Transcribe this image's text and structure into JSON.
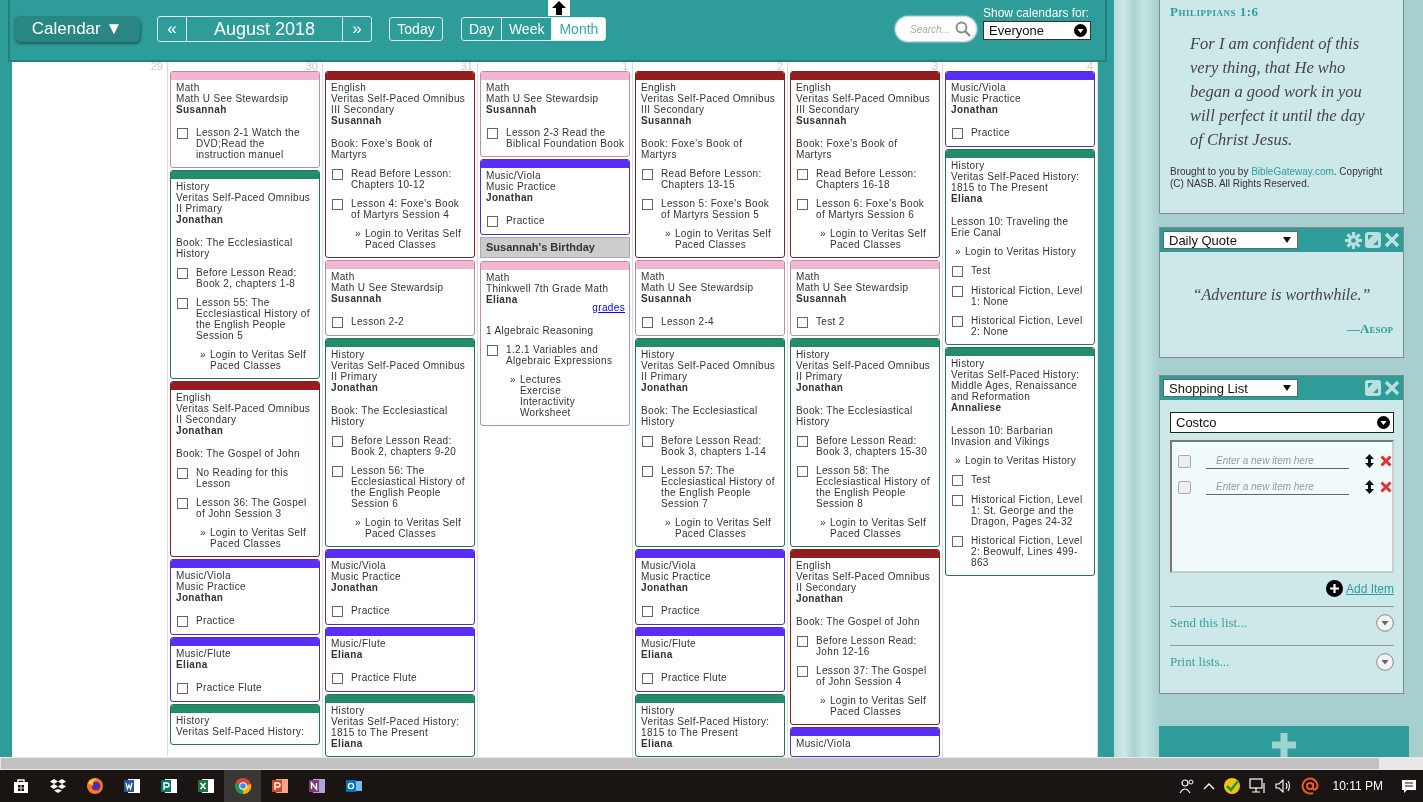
{
  "header": {
    "menu_button": "Calendar ▼",
    "prev": "«",
    "month": "August 2018",
    "next": "»",
    "today": "Today",
    "views": [
      {
        "label": "Day",
        "selected": false
      },
      {
        "label": "Week",
        "selected": false
      },
      {
        "label": "Month",
        "selected": true
      }
    ],
    "search": {
      "placeholder": "Search..."
    },
    "show_label": "Show calendars for:",
    "show_select": "Everyone"
  },
  "calendar": {
    "days": [
      {
        "number": "29"
      },
      {
        "number": "30",
        "cards": [
          {
            "kind": "lesson",
            "color": "#f4b5d3",
            "subject": "Math",
            "course": "Math U See Stewardsip",
            "student": "Susannah",
            "items": [
              {
                "kind": "task",
                "text": "Lesson 2-1 Watch the DVD;Read the instruction manuel",
                "checked": false
              }
            ]
          },
          {
            "kind": "lesson",
            "color": "#238c6b",
            "subject": "History",
            "course": "Veritas Self-Paced Omnibus II Primary",
            "student": "Jonathan",
            "items": [
              {
                "kind": "note",
                "text": "Book: The Ecclesiastical History"
              },
              {
                "kind": "task",
                "text": "Before Lesson Read: Book 2, chapters 1-8",
                "checked": false
              },
              {
                "kind": "task",
                "text": "Lesson 55: The Ecclesiastical History of the English People Session 5",
                "checked": false
              },
              {
                "kind": "link",
                "marker": "»",
                "labels": [
                  "Login to Veritas Self Paced Classes"
                ]
              }
            ]
          },
          {
            "kind": "lesson",
            "color": "#951d1d",
            "subject": "English",
            "course": "Veritas Self-Paced Omnibus II Secondary",
            "student": "Jonathan",
            "items": [
              {
                "kind": "note",
                "text": "Book: The Gospel of John"
              },
              {
                "kind": "task",
                "text": "No Reading for this Lesson",
                "checked": false
              },
              {
                "kind": "task",
                "text": "Lesson 36: The Gospel of John Session 3",
                "checked": false
              },
              {
                "kind": "link",
                "marker": "»",
                "labels": [
                  "Login to Veritas Self Paced Classes"
                ]
              }
            ]
          },
          {
            "kind": "lesson",
            "color": "#5b2ef5",
            "subject": "Music/Viola",
            "course": "Music Practice",
            "student": "Jonathan",
            "items": [
              {
                "kind": "task",
                "text": "Practice",
                "checked": false
              }
            ]
          },
          {
            "kind": "lesson",
            "color": "#5b2ef5",
            "subject": "Music/Flute",
            "student": "Eliana",
            "items": [
              {
                "kind": "task",
                "text": "Practice Flute",
                "checked": false
              }
            ]
          },
          {
            "kind": "lesson",
            "color": "#238c6b",
            "subject": "History",
            "course": "Veritas Self-Paced History:"
          }
        ]
      },
      {
        "number": "31",
        "cards": [
          {
            "kind": "lesson",
            "color": "#951d1d",
            "subject": "English",
            "course": "Veritas Self-Paced Omnibus III Secondary",
            "student": "Susannah",
            "items": [
              {
                "kind": "note",
                "text": "Book: Foxe’s Book of Martyrs"
              },
              {
                "kind": "task",
                "text": "Read Before Lesson: Chapters 10-12",
                "checked": false
              },
              {
                "kind": "task",
                "text": "Lesson 4: Foxe's Book of Martyrs Session 4",
                "checked": false
              },
              {
                "kind": "link",
                "marker": "»",
                "labels": [
                  "Login to Veritas Self Paced Classes"
                ]
              }
            ]
          },
          {
            "kind": "lesson",
            "color": "#f4b5d3",
            "subject": "Math",
            "course": "Math U See Stewardsip",
            "student": "Susannah",
            "items": [
              {
                "kind": "task",
                "text": "Lesson 2-2",
                "checked": false
              }
            ]
          },
          {
            "kind": "lesson",
            "color": "#238c6b",
            "subject": "History",
            "course": "Veritas Self-Paced Omnibus II Primary",
            "student": "Jonathan",
            "items": [
              {
                "kind": "note",
                "text": "Book: The Ecclesiastical History"
              },
              {
                "kind": "task",
                "text": "Before Lesson Read: Book 2, chapters 9-20",
                "checked": false
              },
              {
                "kind": "task",
                "text": "Lesson 56: The Ecclesiastical History of the English People Session 6",
                "checked": false
              },
              {
                "kind": "link",
                "marker": "»",
                "labels": [
                  "Login to Veritas Self Paced Classes"
                ]
              }
            ]
          },
          {
            "kind": "lesson",
            "color": "#5b2ef5",
            "subject": "Music/Viola",
            "course": "Music Practice",
            "student": "Jonathan",
            "items": [
              {
                "kind": "task",
                "text": "Practice",
                "checked": false
              }
            ]
          },
          {
            "kind": "lesson",
            "color": "#5b2ef5",
            "subject": "Music/Flute",
            "student": "Eliana",
            "items": [
              {
                "kind": "task",
                "text": "Practice Flute",
                "checked": false
              }
            ]
          },
          {
            "kind": "lesson",
            "color": "#238c6b",
            "subject": "History",
            "course": "Veritas Self-Paced History: 1815 to The Present",
            "student": "Eliana"
          }
        ]
      },
      {
        "number": "1",
        "cards": [
          {
            "kind": "lesson",
            "color": "#f4b5d3",
            "subject": "Math",
            "course": "Math U See Stewardsip",
            "student": "Susannah",
            "items": [
              {
                "kind": "task",
                "text": "Lesson 2-3 Read the Biblical Foundation Book",
                "checked": false
              }
            ]
          },
          {
            "kind": "lesson",
            "color": "#5b2ef5",
            "subject": "Music/Viola",
            "course": "Music Practice",
            "student": "Jonathan",
            "items": [
              {
                "kind": "task",
                "text": "Practice",
                "checked": false
              }
            ]
          },
          {
            "kind": "event",
            "title": "Susannah's Birthday"
          },
          {
            "kind": "lesson",
            "color": "#f4b5d3",
            "subject": "Math",
            "course": "Thinkwell 7th Grade Math",
            "student": "Eliana",
            "grades": "grades",
            "items": [
              {
                "kind": "note",
                "text": "1 Algebraic Reasoning"
              },
              {
                "kind": "task",
                "text": "1.2.1 Variables and Algebraic Expressions",
                "checked": false
              },
              {
                "kind": "link",
                "marker": "»",
                "labels": [
                  "Lectures",
                  "Exercise",
                  "Interactivity",
                  "Worksheet"
                ]
              }
            ]
          }
        ]
      },
      {
        "number": "2",
        "cards": [
          {
            "kind": "lesson",
            "color": "#951d1d",
            "subject": "English",
            "course": "Veritas Self-Paced Omnibus III Secondary",
            "student": "Susannah",
            "items": [
              {
                "kind": "note",
                "text": "Book: Foxe’s Book of Martyrs"
              },
              {
                "kind": "task",
                "text": "Read Before Lesson: Chapters 13-15",
                "checked": false
              },
              {
                "kind": "task",
                "text": "Lesson 5: Foxe's Book of Martyrs Session 5",
                "checked": false
              },
              {
                "kind": "link",
                "marker": "»",
                "labels": [
                  "Login to Veritas Self Paced Classes"
                ]
              }
            ]
          },
          {
            "kind": "lesson",
            "color": "#f4b5d3",
            "subject": "Math",
            "course": "Math U See Stewardsip",
            "student": "Susannah",
            "items": [
              {
                "kind": "task",
                "text": "Lesson 2-4",
                "checked": false
              }
            ]
          },
          {
            "kind": "lesson",
            "color": "#238c6b",
            "subject": "History",
            "course": "Veritas Self-Paced Omnibus II Primary",
            "student": "Jonathan",
            "items": [
              {
                "kind": "note",
                "text": "Book: The Ecclesiastical History"
              },
              {
                "kind": "task",
                "text": "Before Lesson Read: Book 3, chapters 1-14",
                "checked": false
              },
              {
                "kind": "task",
                "text": "Lesson 57: The Ecclesiastical History of the English People Session 7",
                "checked": false
              },
              {
                "kind": "link",
                "marker": "»",
                "labels": [
                  "Login to Veritas Self Paced Classes"
                ]
              }
            ]
          },
          {
            "kind": "lesson",
            "color": "#5b2ef5",
            "subject": "Music/Viola",
            "course": "Music Practice",
            "student": "Jonathan",
            "items": [
              {
                "kind": "task",
                "text": "Practice",
                "checked": false
              }
            ]
          },
          {
            "kind": "lesson",
            "color": "#5b2ef5",
            "subject": "Music/Flute",
            "student": "Eliana",
            "items": [
              {
                "kind": "task",
                "text": "Practice Flute",
                "checked": false
              }
            ]
          },
          {
            "kind": "lesson",
            "color": "#238c6b",
            "subject": "History",
            "course": "Veritas Self-Paced History: 1815 to The Present",
            "student": "Eliana"
          }
        ]
      },
      {
        "number": "3",
        "cards": [
          {
            "kind": "lesson",
            "color": "#951d1d",
            "subject": "English",
            "course": "Veritas Self-Paced Omnibus III Secondary",
            "student": "Susannah",
            "items": [
              {
                "kind": "note",
                "text": "Book: Foxe’s Book of Martyrs"
              },
              {
                "kind": "task",
                "text": "Read Before Lesson: Chapters 16-18",
                "checked": false
              },
              {
                "kind": "task",
                "text": "Lesson 6: Foxe's Book of Martyrs Session 6",
                "checked": false
              },
              {
                "kind": "link",
                "marker": "»",
                "labels": [
                  "Login to Veritas Self Paced Classes"
                ]
              }
            ]
          },
          {
            "kind": "lesson",
            "color": "#f4b5d3",
            "subject": "Math",
            "course": "Math U See Stewardsip",
            "student": "Susannah",
            "items": [
              {
                "kind": "task",
                "text": "Test 2",
                "checked": false
              }
            ]
          },
          {
            "kind": "lesson",
            "color": "#238c6b",
            "subject": "History",
            "course": "Veritas Self-Paced Omnibus II Primary",
            "student": "Jonathan",
            "items": [
              {
                "kind": "note",
                "text": "Book: The Ecclesiastical History"
              },
              {
                "kind": "task",
                "text": "Before Lesson Read: Book 3, chapters 15-30",
                "checked": false
              },
              {
                "kind": "task",
                "text": "Lesson 58: The Ecclesiastical History of the English People Session 8",
                "checked": false
              },
              {
                "kind": "link",
                "marker": "»",
                "labels": [
                  "Login to Veritas Self Paced Classes"
                ]
              }
            ]
          },
          {
            "kind": "lesson",
            "color": "#951d1d",
            "subject": "English",
            "course": "Veritas Self-Paced Omnibus II Secondary",
            "student": "Jonathan",
            "items": [
              {
                "kind": "note",
                "text": "Book: The Gospel of John"
              },
              {
                "kind": "task",
                "text": "Before Lesson Read: John 12-16",
                "checked": false
              },
              {
                "kind": "task",
                "text": "Lesson 37: The Gospel of John Session 4",
                "checked": false
              },
              {
                "kind": "link",
                "marker": "»",
                "labels": [
                  "Login to Veritas Self Paced Classes"
                ]
              }
            ]
          },
          {
            "kind": "lesson",
            "color": "#5b2ef5",
            "subject": "Music/Viola"
          }
        ]
      },
      {
        "number": "4",
        "cards": [
          {
            "kind": "lesson",
            "color": "#5b2ef5",
            "subject": "Music/Viola",
            "course": "Music Practice",
            "student": "Jonathan",
            "items": [
              {
                "kind": "task",
                "text": "Practice",
                "checked": false
              }
            ]
          },
          {
            "kind": "lesson",
            "color": "#238c6b",
            "subject": "History",
            "course": "Veritas Self-Paced History: 1815 to The Present",
            "student": "Eliana",
            "items": [
              {
                "kind": "note",
                "text": "Lesson 10: Traveling the Erie Canal"
              },
              {
                "kind": "link",
                "marker": "»",
                "labels": [
                  "Login to Veritas History"
                ]
              },
              {
                "kind": "task",
                "text": "Test",
                "checked": false
              },
              {
                "kind": "task",
                "text": "Historical Fiction, Level 1: None",
                "checked": false
              },
              {
                "kind": "task",
                "text": "Historical Fiction, Level 2: None",
                "checked": false
              }
            ]
          },
          {
            "kind": "lesson",
            "color": "#238c6b",
            "subject": "History",
            "course": "Veritas Self-Paced History: Middle Ages, Renaissance and Reformation",
            "student": "Annaliese",
            "items": [
              {
                "kind": "note",
                "text": "Lesson 10: Barbarian Invasion and Vikings"
              },
              {
                "kind": "link",
                "marker": "»",
                "labels": [
                  "Login to Veritas History"
                ]
              },
              {
                "kind": "task",
                "text": "Test",
                "checked": false
              },
              {
                "kind": "task",
                "text": "Historical Fiction, Level 1: St. George and the Dragon, Pages 24-32",
                "checked": false
              },
              {
                "kind": "task",
                "text": "Historical Fiction, Level 2: Beowulf, Lines 499-863",
                "checked": false
              }
            ]
          }
        ]
      }
    ]
  },
  "sidebar": {
    "verse": {
      "reference": "Philippians 1:6",
      "text": "For I am confident of this very thing, that He who began a good work in you will perfect it until the day of Christ Jesus.",
      "credit_prefix": "Brought to you by ",
      "credit_link": "BibleGateway.com",
      "credit_suffix": ". Copyright (C) NASB. All Rights Reserved."
    },
    "quote_widget": {
      "title": "Daily Quote",
      "quote": "“Adventure is worthwhile.”",
      "author": "—Aesop"
    },
    "shopping_widget": {
      "title": "Shopping List",
      "list_select": "Costco",
      "items": [
        {
          "placeholder": "Enter a new item here",
          "checked": false
        },
        {
          "placeholder": "Enter a new item here",
          "checked": false
        }
      ],
      "add_item": "Add Item",
      "sections": [
        {
          "label": "Send this list..."
        },
        {
          "label": "Print lists..."
        }
      ]
    }
  },
  "taskbar": {
    "apps": [
      {
        "kind": "store",
        "selected": false
      },
      {
        "kind": "dropbox",
        "selected": false
      },
      {
        "kind": "firefox",
        "selected": false
      },
      {
        "kind": "word",
        "selected": false
      },
      {
        "kind": "publisher",
        "selected": false
      },
      {
        "kind": "excel",
        "selected": false
      },
      {
        "kind": "chrome",
        "selected": true
      },
      {
        "kind": "powerpoint",
        "selected": false
      },
      {
        "kind": "onenote",
        "selected": false
      },
      {
        "kind": "outlook",
        "selected": false
      }
    ],
    "time": "10:11 PM"
  }
}
